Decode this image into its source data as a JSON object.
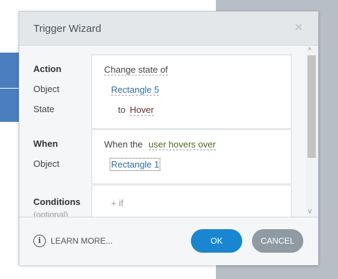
{
  "dialog": {
    "title": "Trigger Wizard",
    "close_glyph": "×"
  },
  "action": {
    "label": "Action",
    "object_label": "Object",
    "state_label": "State",
    "verb": "Change state of",
    "object_value": "Rectangle 5",
    "state_prefix": "to",
    "state_value": "Hover"
  },
  "when": {
    "label": "When",
    "object_label": "Object",
    "prefix": "When the",
    "event": "user hovers over",
    "object_value": "Rectangle 1"
  },
  "conditions": {
    "label": "Conditions",
    "sub_label": "(optional)",
    "add_text": "+ if"
  },
  "scrollbar": {
    "up_glyph": "^",
    "down_glyph": "v"
  },
  "footer": {
    "info_glyph": "i",
    "learn_more": "LEARN MORE...",
    "ok_label": "OK",
    "cancel_label": "CANCEL"
  },
  "colors": {
    "ok": "#1a86d0",
    "cancel": "#8f9aa2",
    "link": "#2d6e9f"
  }
}
